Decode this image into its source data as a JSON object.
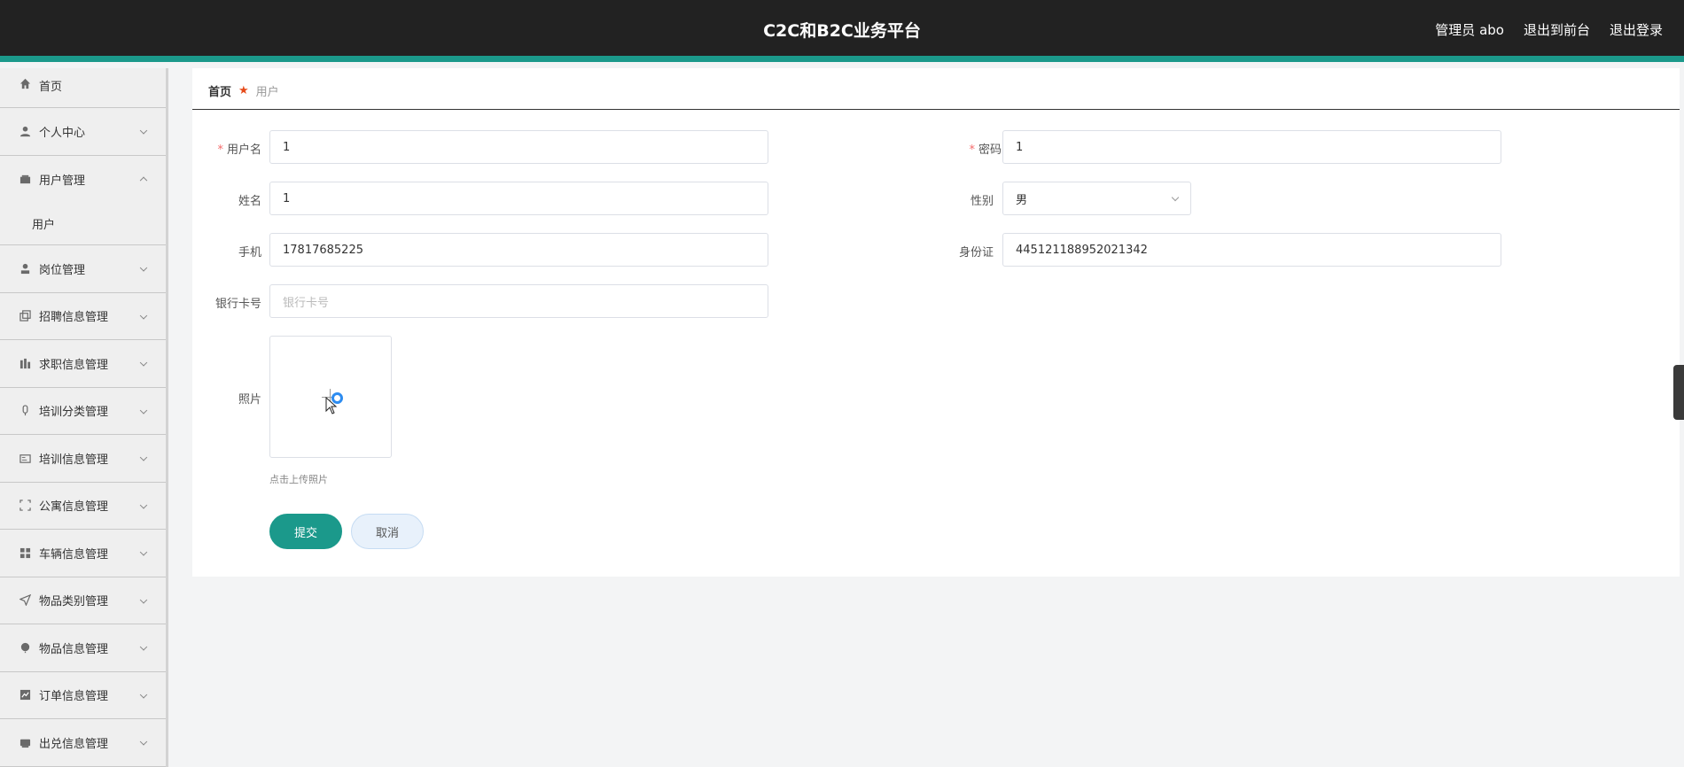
{
  "header": {
    "title": "C2C和B2C业务平台",
    "admin_label": "管理员 abo",
    "front_label": "退出到前台",
    "logout_label": "退出登录"
  },
  "sidebar": {
    "items": [
      {
        "label": "首页",
        "icon": "home-icon"
      },
      {
        "label": "个人中心",
        "icon": "user-icon"
      },
      {
        "label": "用户管理",
        "icon": "wallet-icon",
        "open": true,
        "sub": [
          "用户"
        ]
      },
      {
        "label": "岗位管理",
        "icon": "person-icon"
      },
      {
        "label": "招聘信息管理",
        "icon": "copy-icon"
      },
      {
        "label": "求职信息管理",
        "icon": "stats-icon"
      },
      {
        "label": "培训分类管理",
        "icon": "mic-icon"
      },
      {
        "label": "培训信息管理",
        "icon": "card-icon"
      },
      {
        "label": "公寓信息管理",
        "icon": "fullscreen-icon"
      },
      {
        "label": "车辆信息管理",
        "icon": "grid-icon"
      },
      {
        "label": "物品类别管理",
        "icon": "send-icon"
      },
      {
        "label": "物品信息管理",
        "icon": "balloon-icon"
      },
      {
        "label": "订单信息管理",
        "icon": "chart-icon"
      },
      {
        "label": "出兑信息管理",
        "icon": "printer-icon"
      }
    ]
  },
  "breadcrumb": {
    "home": "首页",
    "current": "用户"
  },
  "form": {
    "username_label": "用户名",
    "username_value": "1",
    "password_label": "密码",
    "password_value": "1",
    "name_label": "姓名",
    "name_value": "1",
    "gender_label": "性别",
    "gender_value": "男",
    "phone_label": "手机",
    "phone_value": "17817685225",
    "idcard_label": "身份证",
    "idcard_value": "445121188952021342",
    "bank_label": "银行卡号",
    "bank_placeholder": "银行卡号",
    "photo_label": "照片",
    "upload_tip": "点击上传照片",
    "submit_label": "提交",
    "cancel_label": "取消"
  },
  "colors": {
    "accent": "#1b998b",
    "header_bg": "#222222",
    "required": "#f56c6c"
  }
}
